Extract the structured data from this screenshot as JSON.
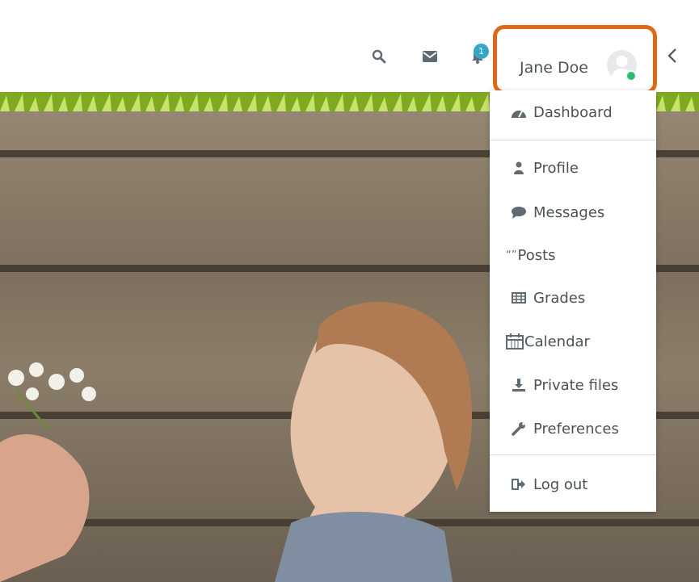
{
  "user": {
    "name": "Jane Doe",
    "status": "online"
  },
  "notifications": {
    "count": "1"
  },
  "icons": [
    "search-icon",
    "mail-icon",
    "bell-icon",
    "user-avatar",
    "chevron-left-icon"
  ],
  "colors": {
    "highlight": "#de6818",
    "badge": "#33a6c9",
    "online": "#2abf6b",
    "header_stripe": "#7fa91f"
  },
  "menu": {
    "dashboard": "Dashboard",
    "profile": "Profile",
    "messages": "Messages",
    "posts": "Posts",
    "grades": "Grades",
    "calendar": "Calendar",
    "private_files": "Private files",
    "preferences": "Preferences",
    "logout": "Log out"
  }
}
